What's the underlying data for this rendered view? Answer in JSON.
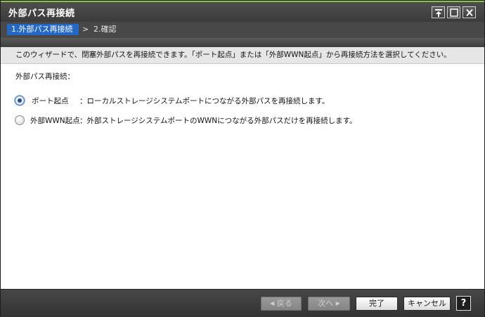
{
  "window": {
    "title": "外部パス再接続",
    "controls": {
      "pin_icon": "pin-icon",
      "maximize_icon": "maximize-icon",
      "close_icon": "close-icon"
    }
  },
  "steps": {
    "current": "1.外部パス再接続",
    "separator": ">",
    "next": "2.確認"
  },
  "content": {
    "description": "このウィザードで、閉塞外部パスを再接続できます。「ポート起点」または「外部WWN起点」から再接続方法を選択してください。",
    "section_label": "外部パス再接続：",
    "options": [
      {
        "label": "ポート起点",
        "description": "：ローカルストレージシステムポートにつながる外部パスを再接続します。",
        "selected": true
      },
      {
        "label": "外部WWN起点",
        "description": "：外部ストレージシステムポートのWWNにつながる外部パスだけを再接続します。",
        "selected": false
      }
    ]
  },
  "footer": {
    "back_label": "戻る",
    "next_label": "次へ",
    "finish_label": "完了",
    "cancel_label": "キャンセル",
    "help_label": "?"
  },
  "colors": {
    "accent_green": "#8fc43a",
    "step_active_blue": "#2368c7",
    "radio_selected": "#1d4f9c"
  }
}
